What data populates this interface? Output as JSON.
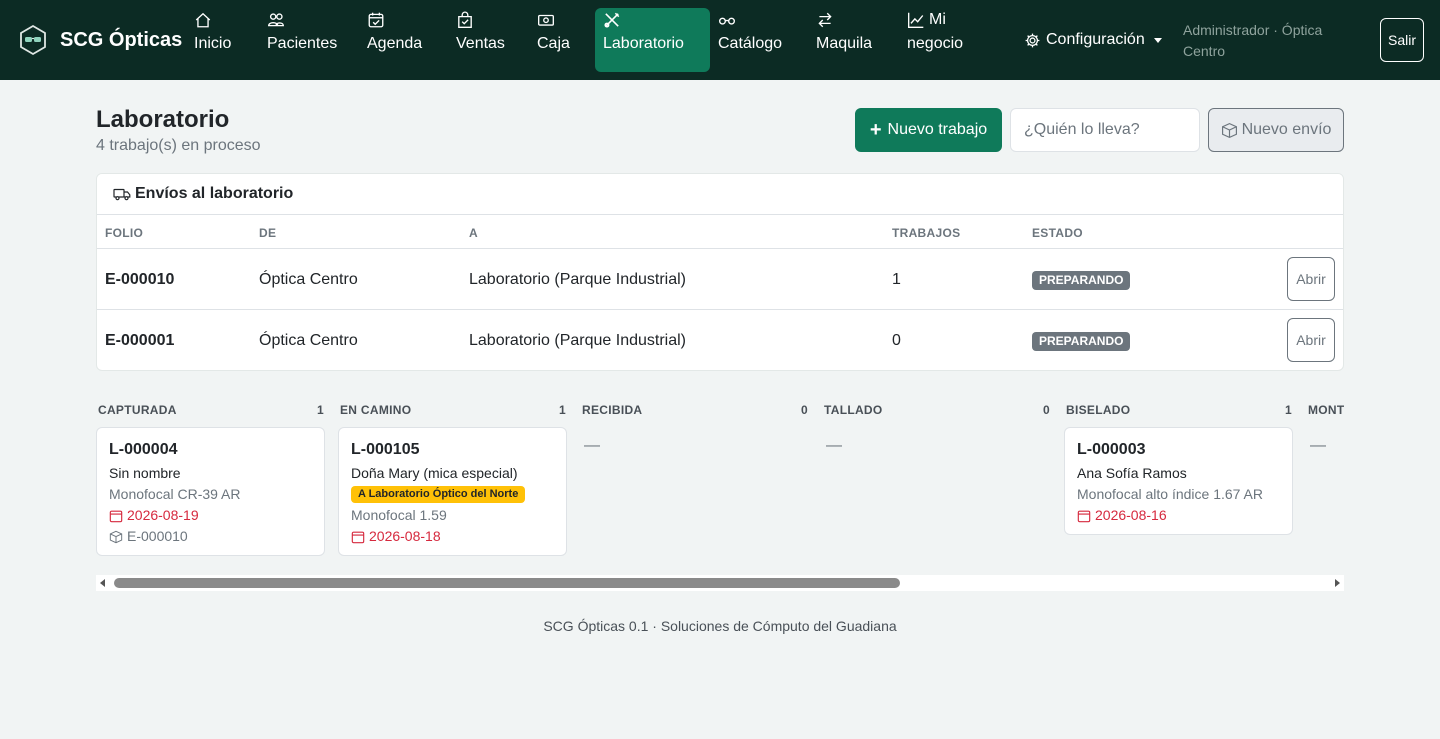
{
  "brand": {
    "name": "SCG Ópticas",
    "logo_icon": "glasses-hexagon-icon"
  },
  "nav": [
    {
      "label": "Inicio",
      "icon": "house-icon"
    },
    {
      "label": "Pacientes",
      "icon": "people-icon"
    },
    {
      "label": "Agenda",
      "icon": "calendar-check-icon"
    },
    {
      "label": "Ventas",
      "icon": "bag-check-icon"
    },
    {
      "label": "Caja",
      "icon": "cash-icon"
    },
    {
      "label": "Laboratorio",
      "icon": "tools-icon",
      "active": true
    },
    {
      "label": "Catálogo",
      "icon": "eyeglasses-icon"
    },
    {
      "label": "Maquila",
      "icon": "arrow-left-right-icon"
    },
    {
      "label_line1": "Mi",
      "label_line2": "negocio",
      "icon": "graph-up-icon"
    }
  ],
  "config": {
    "label": "Configuración",
    "icon": "gear-icon"
  },
  "user": {
    "info": "Administrador · Óptica Centro"
  },
  "logout": {
    "label": "Salir"
  },
  "page": {
    "title": "Laboratorio",
    "subtitle": "4 trabajo(s) en proceso",
    "new_job_label": "Nuevo trabajo",
    "who_placeholder": "¿Quién lo lleva?",
    "new_shipment_label": "Nuevo envío"
  },
  "shipments": {
    "title": "Envíos al laboratorio",
    "columns": [
      "FOLIO",
      "DE",
      "A",
      "TRABAJOS",
      "ESTADO"
    ],
    "rows": [
      {
        "folio": "E-000010",
        "from": "Óptica Centro",
        "to": "Laboratorio (Parque Industrial)",
        "jobs": "1",
        "state": "PREPARANDO",
        "action": "Abrir"
      },
      {
        "folio": "E-000001",
        "from": "Óptica Centro",
        "to": "Laboratorio (Parque Industrial)",
        "jobs": "0",
        "state": "PREPARANDO",
        "action": "Abrir"
      }
    ]
  },
  "kanban": {
    "columns": [
      {
        "name": "CAPTURADA",
        "count": "1"
      },
      {
        "name": "EN CAMINO",
        "count": "1"
      },
      {
        "name": "RECIBIDA",
        "count": "0"
      },
      {
        "name": "TALLADO",
        "count": "0"
      },
      {
        "name": "BISELADO",
        "count": "1"
      },
      {
        "name": "MONT"
      }
    ],
    "empty": "—",
    "cards": {
      "capturada": {
        "code": "L-000004",
        "name": "Sin nombre",
        "product": "Monofocal CR-39 AR",
        "date": "2026-08-19",
        "shipment": "E-000010"
      },
      "en_camino": {
        "code": "L-000105",
        "name": "Doña Mary (mica especial)",
        "badge": "A Laboratorio Óptico del Norte",
        "product": "Monofocal 1.59",
        "date": "2026-08-18"
      },
      "biselado": {
        "code": "L-000003",
        "name": "Ana Sofía Ramos",
        "product": "Monofocal alto índice 1.67 AR",
        "date": "2026-08-16"
      }
    }
  },
  "footer": {
    "text": "SCG Ópticas 0.1 · Soluciones de Cómputo del Guadiana"
  },
  "colors": {
    "navbar": "#0c2b24",
    "accent": "#0f7a5a",
    "danger": "#d6293e",
    "warning": "#ffc107",
    "muted": "#6c757d"
  }
}
